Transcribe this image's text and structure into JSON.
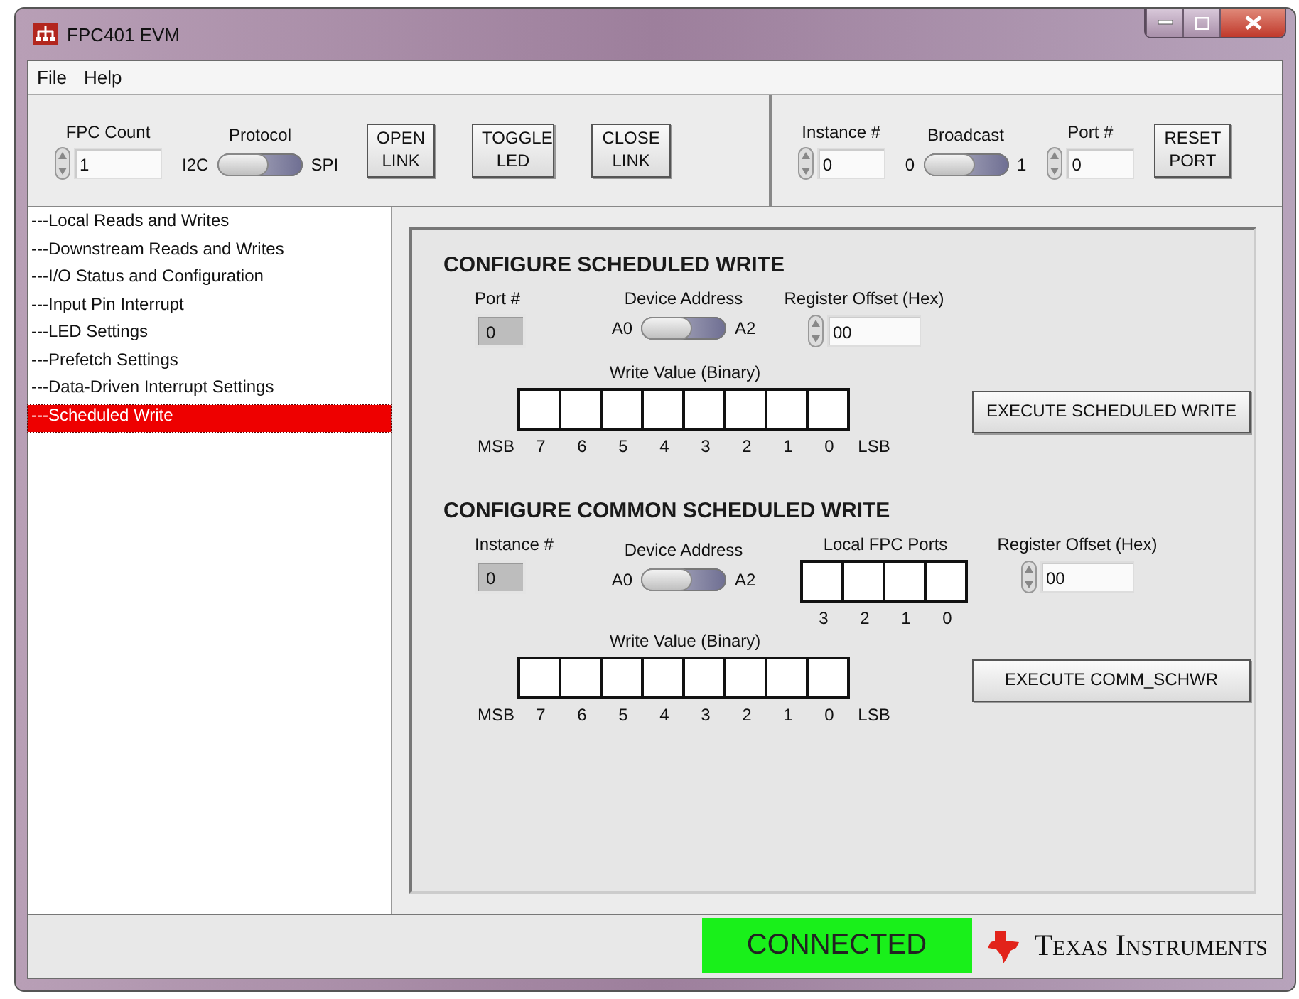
{
  "window": {
    "title": "FPC401 EVM"
  },
  "menu": [
    "File",
    "Help"
  ],
  "toolbar": {
    "fpc_count": {
      "label": "FPC Count",
      "value": "1"
    },
    "protocol": {
      "label": "Protocol",
      "off_label": "I2C",
      "on_label": "SPI",
      "on": false
    },
    "link_buttons": [
      "OPEN LINK",
      "TOGGLE LED",
      "CLOSE LINK"
    ],
    "instance": {
      "label": "Instance #",
      "value": "0"
    },
    "broadcast": {
      "label": "Broadcast",
      "off_label": "0",
      "on_label": "1",
      "on": false
    },
    "port": {
      "label": "Port #",
      "value": "0"
    },
    "reset_button": "RESET PORT"
  },
  "sidebar": {
    "items": [
      {
        "label": "---Local Reads and Writes",
        "selected": false
      },
      {
        "label": "---Downstream Reads and Writes",
        "selected": false
      },
      {
        "label": "---I/O Status and Configuration",
        "selected": false
      },
      {
        "label": "---Input Pin Interrupt",
        "selected": false
      },
      {
        "label": "---LED Settings",
        "selected": false
      },
      {
        "label": "---Prefetch Settings",
        "selected": false
      },
      {
        "label": "---Data-Driven Interrupt Settings",
        "selected": false
      },
      {
        "label": "---Scheduled Write",
        "selected": true
      }
    ]
  },
  "sections": [
    {
      "title": "CONFIGURE SCHEDULED WRITE",
      "indicator": {
        "label": "Port #",
        "value": "0"
      },
      "device_address": {
        "label": "Device Address",
        "off_label": "A0",
        "on_label": "A2",
        "on": false
      },
      "register_offset": {
        "label": "Register Offset (Hex)",
        "value": "00"
      },
      "write_value": {
        "label": "Write Value (Binary)",
        "bit_labels": [
          "MSB",
          "7",
          "6",
          "5",
          "4",
          "3",
          "2",
          "1",
          "0",
          "LSB"
        ]
      },
      "button": "EXECUTE SCHEDULED WRITE"
    },
    {
      "title": "CONFIGURE COMMON SCHEDULED WRITE",
      "indicator": {
        "label": "Instance #",
        "value": "0"
      },
      "device_address": {
        "label": "Device Address",
        "off_label": "A0",
        "on_label": "A2",
        "on": false
      },
      "local_ports": {
        "label": "Local FPC Ports",
        "bit_labels": [
          "3",
          "2",
          "1",
          "0"
        ]
      },
      "register_offset": {
        "label": "Register Offset (Hex)",
        "value": "00"
      },
      "write_value": {
        "label": "Write Value (Binary)",
        "bit_labels": [
          "MSB",
          "7",
          "6",
          "5",
          "4",
          "3",
          "2",
          "1",
          "0",
          "LSB"
        ]
      },
      "button": "EXECUTE COMM_SCHWR"
    }
  ],
  "status_bar": {
    "status": {
      "text": "CONNECTED",
      "connected": true
    },
    "logo_text": "Texas Instruments"
  }
}
